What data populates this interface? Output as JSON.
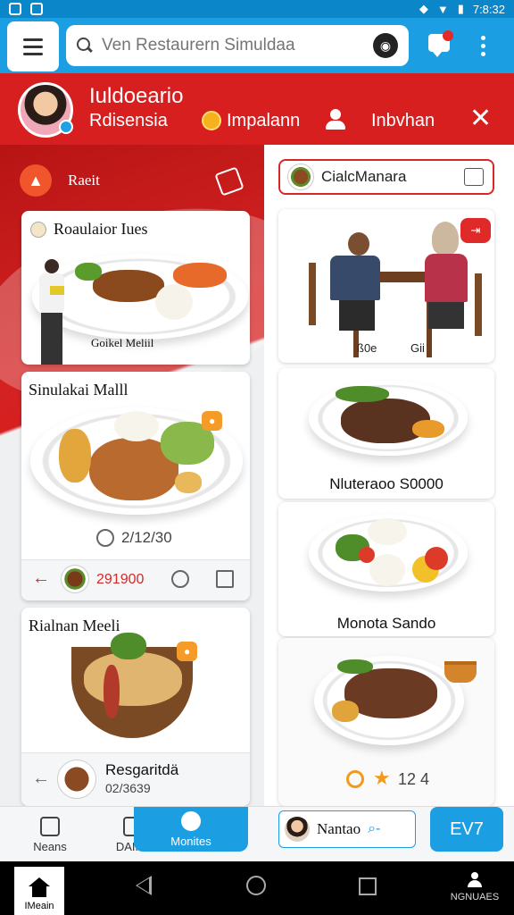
{
  "status_bar": {
    "time": "7:8:32"
  },
  "search": {
    "placeholder": "Ven Restaurern Simuldaa",
    "value": ""
  },
  "header": {
    "name": "Iuldoeario",
    "subtitle": "Rdisensia",
    "points_label": "Impalann",
    "inbox_label": "Inbvhan"
  },
  "left_panel": {
    "filter_label": "Raeit",
    "cards": [
      {
        "title": "Roaulaior Iues",
        "caption": "Goikel Meliil"
      },
      {
        "title": "Sinulakai Malll",
        "rating": "2/12/30",
        "price": "291900"
      },
      {
        "title": "Rialnan Meeli",
        "name": "Resgaritdä",
        "code": "02/3639"
      }
    ]
  },
  "right_panel": {
    "recommend_label": "CialcManara",
    "cards": [
      {
        "caption_left": "ß0e",
        "caption_right": "Gii"
      },
      {
        "caption": "Nluteraoo S0000"
      },
      {
        "caption": "Monota Sando"
      },
      {
        "rating": "12 4"
      }
    ]
  },
  "bottom_nav": {
    "items": [
      {
        "label": "Neans"
      },
      {
        "label": "DAINo"
      },
      {
        "label": "Monites"
      }
    ],
    "mini_label": "Nantao",
    "ev_label": "EV7"
  },
  "system_nav": {
    "home_label": "IMeain",
    "profile_label": "NGNUAES"
  },
  "colors": {
    "primary": "#1c9ee3",
    "accent_red": "#d71f1f",
    "badge_orange": "#f59b2a"
  }
}
